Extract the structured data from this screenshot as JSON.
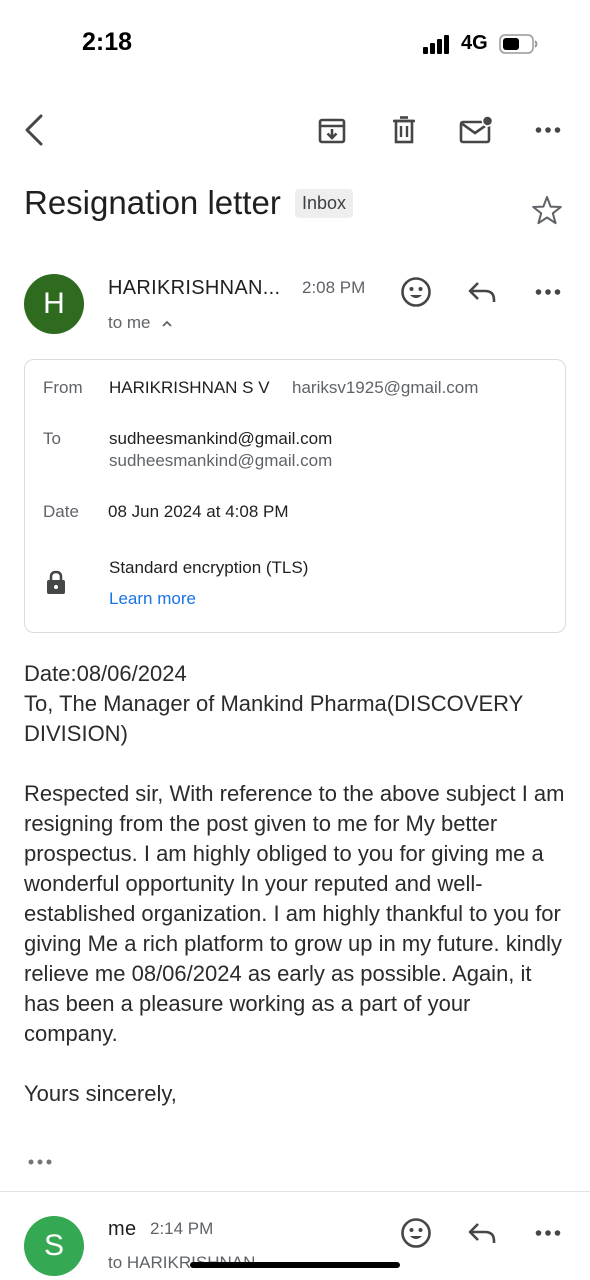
{
  "status": {
    "time": "2:18",
    "network": "4G",
    "signal_bars": 4
  },
  "toolbar": {
    "back_icon": "back-arrow-icon",
    "archive_icon": "archive-icon",
    "delete_icon": "trash-icon",
    "mark_unread_icon": "mail-unread-icon",
    "more_icon": "more-horizontal-icon"
  },
  "email": {
    "subject": "Resignation letter",
    "label": "Inbox",
    "starred": false
  },
  "message": {
    "avatar_letter": "H",
    "avatar_color": "#2e6b1f",
    "sender_name": "HARIKRISHNAN...",
    "time": "2:08 PM",
    "recipient_summary": "to me",
    "details": {
      "from_label": "From",
      "from_name": "HARIKRISHNAN S V",
      "from_email": "hariksv1925@gmail.com",
      "to_label": "To",
      "to_name": "sudheesmankind@gmail.com",
      "to_email": "sudheesmankind@gmail.com",
      "date_label": "Date",
      "date_value": "08 Jun 2024 at 4:08 PM",
      "encryption": "Standard encryption (TLS)",
      "learn_more": "Learn more"
    },
    "body": [
      "Date:08/06/2024",
      "To, The Manager of Mankind Pharma(DISCOVERY DIVISION)",
      "",
      "Respected sir, With reference to the above subject I am resigning from the post given to me for My better prospectus. I am highly obliged to you for giving me a wonderful opportunity In your reputed and well-established organization. I am highly thankful to you for giving Me a rich platform to grow up in my future. kindly relieve me 08/06/2024 as early as possible. Again, it has been a pleasure working as a part of your company.",
      "",
      "Yours sincerely,"
    ]
  },
  "reply": {
    "avatar_letter": "S",
    "avatar_color": "#34a853",
    "sender_name": "me",
    "time": "2:14 PM",
    "recipient_summary": "to HARIKRISHNAN"
  },
  "colors": {
    "link": "#1a73e8",
    "icon": "#444746"
  }
}
